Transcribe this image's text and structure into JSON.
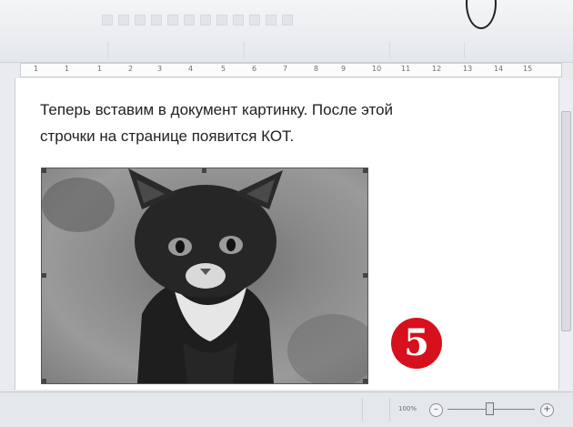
{
  "document": {
    "paragraph_lines": [
      "Теперь вставим в документ картинку. После этой",
      "строчки на странице появится КОТ."
    ]
  },
  "ruler": {
    "numbers": [
      "1",
      "1",
      "1",
      "2",
      "3",
      "4",
      "5",
      "6",
      "7",
      "8",
      "9",
      "10",
      "11",
      "12",
      "13",
      "14",
      "15"
    ]
  },
  "annotation": {
    "step_number": "5",
    "badge_color": "#d6101c"
  },
  "statusbar": {
    "zoom_label": "100%",
    "zoom_out_symbol": "–",
    "zoom_in_symbol": "+"
  },
  "image": {
    "icon": "kitten-photo"
  }
}
